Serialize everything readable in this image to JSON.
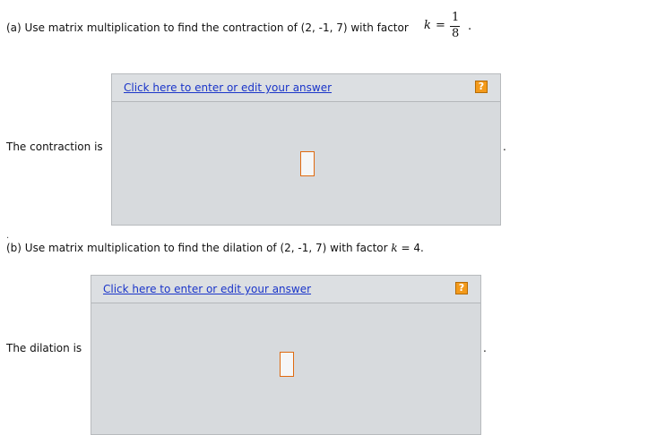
{
  "part_a": {
    "prompt": "(a) Use matrix multiplication to find the contraction of (2, -1, 7) with factor",
    "factor": {
      "var": "k",
      "equals": "=",
      "numerator": "1",
      "denominator": "8",
      "end": "."
    },
    "link_label": "Click here to enter or edit your answer",
    "help_label": "?",
    "answer_label": "The contraction is",
    "end_punct": "."
  },
  "separator_dot": ".",
  "part_b": {
    "prompt": "(b) Use matrix multiplication to find the dilation of (2, -1, 7) with factor",
    "factor_var": "k",
    "factor_value": "= 4.",
    "link_label": "Click here to enter or edit your answer",
    "help_label": "?",
    "answer_label": "The dilation is",
    "end_punct": "."
  },
  "colors": {
    "link": "#1a35c9",
    "help_button": "#f39a1b",
    "answer_box_border": "#e06a10",
    "panel_background": "#d7dadd"
  }
}
